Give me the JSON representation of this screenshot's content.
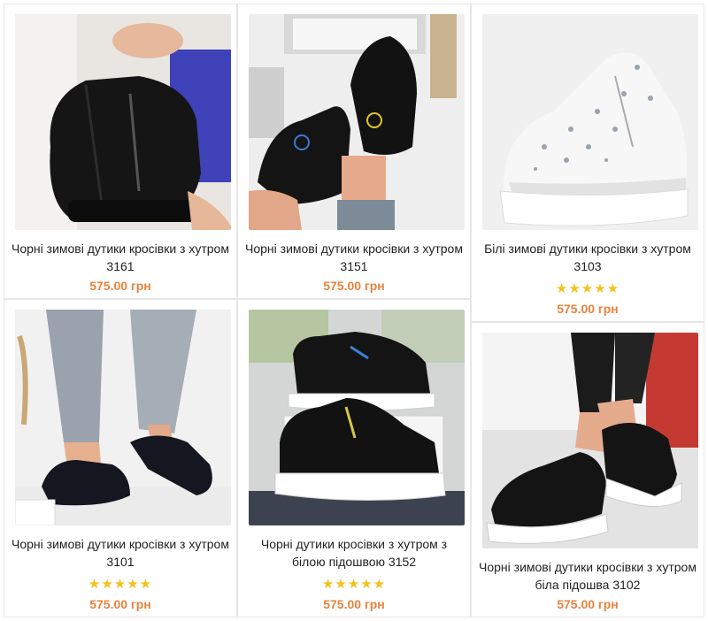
{
  "colors": {
    "accent_price": "#e8823c",
    "stars": "#f3c21a",
    "border": "#e6e6e6"
  },
  "products": [
    {
      "title": "Чорні зимові дутики кросівки з хутром 3161",
      "price": "575.00 грн",
      "rating_stars": ""
    },
    {
      "title": "Чорні зимові дутики кросівки з хутром 3151",
      "price": "575.00 грн",
      "rating_stars": ""
    },
    {
      "title": "Білі зимові дутики кросівки з хутром 3103",
      "price": "575.00 грн",
      "rating_stars": "★★★★★"
    },
    {
      "title": "Чорні зимові дутики кросівки з хутром 3101",
      "price": "575.00 грн",
      "rating_stars": "★★★★★"
    },
    {
      "title": "Чорні дутики кросівки з хутром з білою підошвою 3152",
      "price": "575.00 грн",
      "rating_stars": "★★★★★"
    },
    {
      "title": "Чорні зимові дутики кросівки з хутром біла підошва 3102",
      "price": "575.00 грн",
      "rating_stars": ""
    }
  ]
}
